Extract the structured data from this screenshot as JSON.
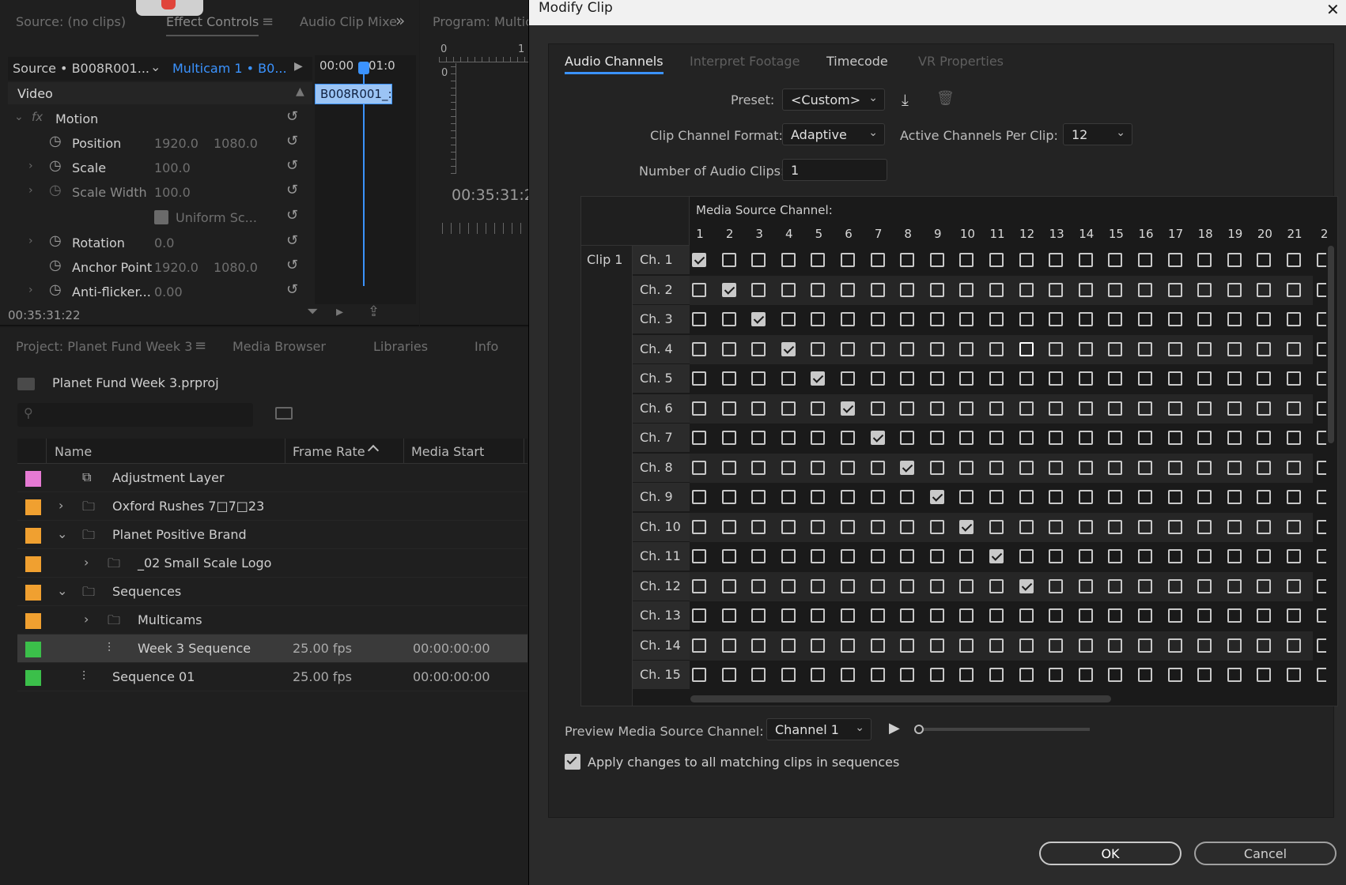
{
  "source_panel": {
    "tabs": [
      "Source: (no clips)",
      "Effect Controls",
      "Audio Clip Mixe",
      "Program: Multic"
    ],
    "overflow_glyph": "»",
    "menu_glyph": "≡",
    "source_dropdown": "Source • B008R001...",
    "sequence_link": "Multicam 1 • B0...",
    "clip_label": "B008R001_:",
    "ruler_start": "00:00",
    "ruler_mark": "01:0",
    "video_header": "Video",
    "motion_label": "Motion",
    "fx_label": "fx",
    "properties": [
      {
        "label": "Position",
        "v1": "1920.0",
        "v2": "1080.0"
      },
      {
        "label": "Scale",
        "v1": "100.0",
        "v2": ""
      },
      {
        "label": "Scale Width",
        "v1": "100.0",
        "v2": ""
      },
      {
        "label": "Uniform Sc...",
        "v1": "",
        "v2": ""
      },
      {
        "label": "Rotation",
        "v1": "0.0",
        "v2": ""
      },
      {
        "label": "Anchor Point",
        "v1": "1920.0",
        "v2": "1080.0"
      },
      {
        "label": "Anti-flicker...",
        "v1": "0.00",
        "v2": ""
      }
    ],
    "timecode": "00:35:31:22"
  },
  "program_panel": {
    "timecode": "00:35:31:2",
    "ruler_zero": "0",
    "ruler_one": "1",
    "vruler_zero": "0"
  },
  "project_panel": {
    "tabs": [
      "Project: Planet Fund Week 3",
      "Media Browser",
      "Libraries",
      "Info"
    ],
    "project_file": "Planet Fund Week 3.prproj",
    "columns": [
      "Name",
      "Frame Rate",
      "Media Start"
    ],
    "sort_glyph": "^",
    "items": [
      {
        "name": "Adjustment Layer",
        "color": "#e67ad4",
        "frame_rate": "",
        "media_start": ""
      },
      {
        "name": "Oxford Rushes 7□7□23",
        "color": "#f0a030",
        "frame_rate": "",
        "media_start": ""
      },
      {
        "name": "Planet Positive Brand",
        "color": "#f0a030",
        "frame_rate": "",
        "media_start": ""
      },
      {
        "name": "_02 Small Scale Logo",
        "color": "#f0a030",
        "frame_rate": "",
        "media_start": ""
      },
      {
        "name": "Sequences",
        "color": "#f0a030",
        "frame_rate": "",
        "media_start": ""
      },
      {
        "name": "Multicams",
        "color": "#f0a030",
        "frame_rate": "",
        "media_start": ""
      },
      {
        "name": "Week 3 Sequence",
        "color": "#3bbf4a",
        "frame_rate": "25.00 fps",
        "media_start": "00:00:00:00"
      },
      {
        "name": "Sequence 01",
        "color": "#3bbf4a",
        "frame_rate": "25.00 fps",
        "media_start": "00:00:00:00"
      }
    ]
  },
  "dialog": {
    "title": "Modify Clip",
    "close_glyph": "✕",
    "tabs": [
      "Audio Channels",
      "Interpret Footage",
      "Timecode",
      "VR Properties"
    ],
    "preset_label": "Preset:",
    "preset_value": "<Custom>",
    "format_label": "Clip Channel Format:",
    "format_value": "Adaptive",
    "active_label": "Active Channels Per Clip:",
    "active_value": "12",
    "num_clips_label": "Number of Audio Clips:",
    "num_clips_value": "1",
    "media_source_label": "Media Source Channel:",
    "clip_label": "Clip 1",
    "column_numbers": [
      "1",
      "2",
      "3",
      "4",
      "5",
      "6",
      "7",
      "8",
      "9",
      "10",
      "11",
      "12",
      "13",
      "14",
      "15",
      "16",
      "17",
      "18",
      "19",
      "20",
      "21",
      "2"
    ],
    "channels": [
      "Ch. 1",
      "Ch. 2",
      "Ch. 3",
      "Ch. 4",
      "Ch. 5",
      "Ch. 6",
      "Ch. 7",
      "Ch. 8",
      "Ch. 9",
      "Ch. 10",
      "Ch. 11",
      "Ch. 12",
      "Ch. 13",
      "Ch. 14",
      "Ch. 15"
    ],
    "checked_column_per_channel": [
      1,
      2,
      3,
      4,
      5,
      6,
      7,
      8,
      9,
      10,
      11,
      12,
      0,
      0,
      0
    ],
    "preview_label": "Preview Media Source Channel:",
    "preview_value": "Channel 1",
    "apply_label": "Apply changes to all matching clips in sequences",
    "ok_label": "OK",
    "cancel_label": "Cancel"
  }
}
